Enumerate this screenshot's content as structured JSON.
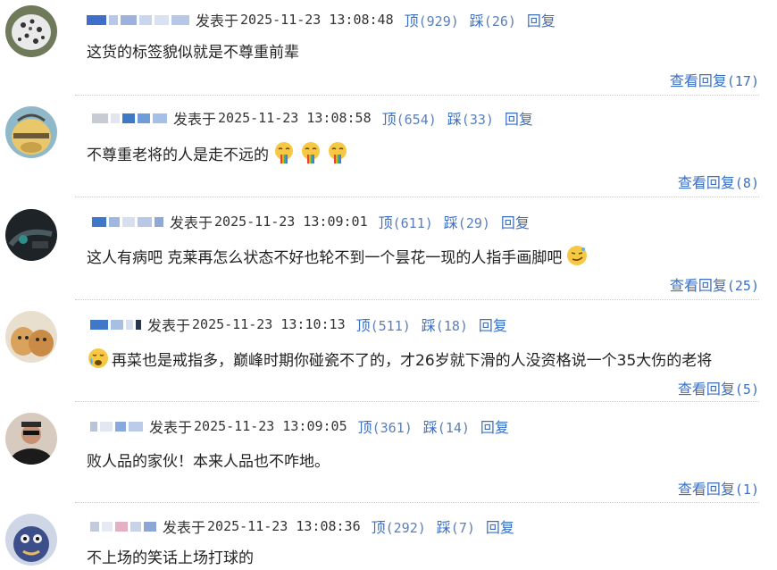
{
  "labels": {
    "posted": "发表于",
    "up": "顶",
    "down": "踩",
    "reply": "回复",
    "view_replies": "查看回复"
  },
  "colors": {
    "link": "#3a6fc4",
    "text": "#222222",
    "meta": "#333333",
    "separator": "#c9c9c9"
  },
  "comments": [
    {
      "time": "2025-11-23 13:08:48",
      "up": "(929)",
      "down": "(26)",
      "text": "这货的标签貌似就是不尊重前辈",
      "emojis": [],
      "replies": "(17)"
    },
    {
      "time": "2025-11-23 13:08:58",
      "up": "(654)",
      "down": "(33)",
      "text": "不尊重老将的人是走不远的",
      "emojis": [
        "rainbow-vomit-emoji",
        "rainbow-vomit-emoji",
        "rainbow-vomit-emoji"
      ],
      "replies": "(8)"
    },
    {
      "time": "2025-11-23 13:09:01",
      "up": "(611)",
      "down": "(29)",
      "text": "这人有病吧 克莱再怎么状态不好也轮不到一个昙花一现的人指手画脚吧",
      "emojis": [
        "smirk-emoji"
      ],
      "replies": "(25)"
    },
    {
      "time": "2025-11-23 13:10:13",
      "up": "(511)",
      "down": "(18)",
      "text": "再菜也是戒指多，巅峰时期你碰瓷不了的，才26岁就下滑的人没资格说一个35大伤的老将",
      "emojis": [
        "crying-emoji"
      ],
      "replies": "(5)"
    },
    {
      "time": "2025-11-23 13:09:05",
      "up": "(361)",
      "down": "(14)",
      "text": "败人品的家伙！本来人品也不咋地。",
      "emojis": [],
      "replies": "(1)"
    },
    {
      "time": "2025-11-23 13:08:36",
      "up": "(292)",
      "down": "(7)",
      "text": "不上场的笑话上场打球的",
      "emojis": [],
      "replies": ""
    }
  ]
}
